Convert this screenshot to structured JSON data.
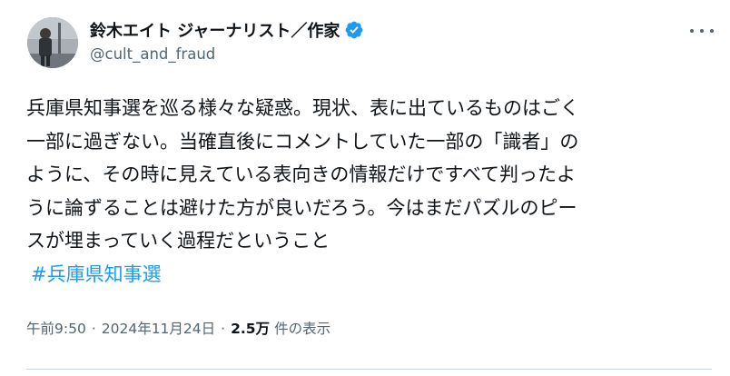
{
  "author": {
    "display_name": "鈴木エイト ジャーナリスト／作家",
    "handle": "@cult_and_fraud",
    "verified": true
  },
  "tweet": {
    "lines": [
      "兵庫県知事選を巡る様々な疑惑。現状、表に出ているものはごく",
      "一部に過ぎない。当確直後にコメントしていた一部の「識者」の",
      "ように、その時に見えている表向きの情報だけですべて判ったよ",
      "うに論ずることは避けた方が良いだろう。今はまだパズルのピー",
      "スが埋まっていく過程だということ"
    ],
    "hashtag": "#兵庫県知事選"
  },
  "meta": {
    "time": "午前9:50",
    "separator": "·",
    "date": "2024年11月24日",
    "views_count": "2.5万",
    "views_label": "件の表示"
  },
  "icons": {
    "more": "more-horizontal-icon",
    "verified": "verified-badge-icon"
  },
  "colors": {
    "text": "#0f1419",
    "secondary": "#536471",
    "link": "#1d9bf0",
    "verified": "#1d9bf0",
    "divider": "#cfd9de"
  }
}
